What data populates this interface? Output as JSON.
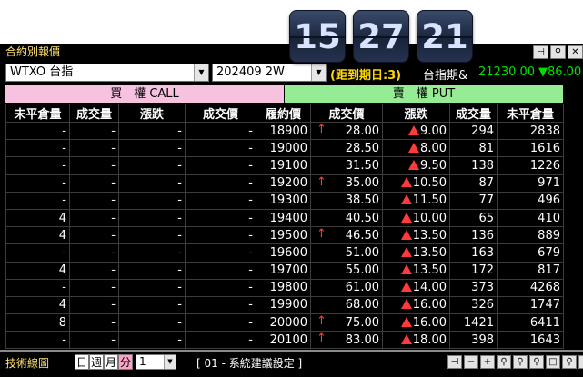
{
  "clock": {
    "hour": "15",
    "minute": "27",
    "second": "21"
  },
  "panel": {
    "title": "合約別報價",
    "title_buttons": [
      "⊣",
      "⚲",
      "✕"
    ]
  },
  "controls": {
    "product": "WTXO 台指",
    "month": "202409 2W",
    "expire_text": "(距到期日:3)",
    "index_name": "台指期&",
    "index_value": "21230.00",
    "index_change": "▼86.00"
  },
  "headers": {
    "call": "買　權 CALL",
    "put": "賣　權 PUT",
    "columns": [
      "未平倉量",
      "成交量",
      "漲跌",
      "成交價",
      "履約價",
      "成交價",
      "漲跌",
      "成交量",
      "未平倉量"
    ]
  },
  "rows": [
    {
      "c_oi": "-",
      "c_vol": "-",
      "c_chg": "-",
      "c_price": "-",
      "strike": "18900",
      "p_up": true,
      "p_price": "28.00",
      "p_chg": "9.00",
      "p_vol": "294",
      "p_oi": "2838"
    },
    {
      "c_oi": "-",
      "c_vol": "-",
      "c_chg": "-",
      "c_price": "-",
      "strike": "19000",
      "p_up": false,
      "p_price": "28.50",
      "p_chg": "8.00",
      "p_vol": "81",
      "p_oi": "1616"
    },
    {
      "c_oi": "-",
      "c_vol": "-",
      "c_chg": "-",
      "c_price": "-",
      "strike": "19100",
      "p_up": false,
      "p_price": "31.50",
      "p_chg": "9.50",
      "p_vol": "138",
      "p_oi": "1226"
    },
    {
      "c_oi": "-",
      "c_vol": "-",
      "c_chg": "-",
      "c_price": "-",
      "strike": "19200",
      "p_up": true,
      "p_price": "35.00",
      "p_chg": "10.50",
      "p_vol": "87",
      "p_oi": "971"
    },
    {
      "c_oi": "-",
      "c_vol": "-",
      "c_chg": "-",
      "c_price": "-",
      "strike": "19300",
      "p_up": false,
      "p_price": "38.50",
      "p_chg": "11.50",
      "p_vol": "77",
      "p_oi": "496"
    },
    {
      "c_oi": "4",
      "c_vol": "-",
      "c_chg": "-",
      "c_price": "-",
      "strike": "19400",
      "p_up": false,
      "p_price": "40.50",
      "p_chg": "10.00",
      "p_vol": "65",
      "p_oi": "410"
    },
    {
      "c_oi": "4",
      "c_vol": "-",
      "c_chg": "-",
      "c_price": "-",
      "strike": "19500",
      "p_up": true,
      "p_price": "46.50",
      "p_chg": "13.50",
      "p_vol": "136",
      "p_oi": "889"
    },
    {
      "c_oi": "-",
      "c_vol": "-",
      "c_chg": "-",
      "c_price": "-",
      "strike": "19600",
      "p_up": false,
      "p_price": "51.00",
      "p_chg": "13.50",
      "p_vol": "163",
      "p_oi": "679"
    },
    {
      "c_oi": "4",
      "c_vol": "-",
      "c_chg": "-",
      "c_price": "-",
      "strike": "19700",
      "p_up": false,
      "p_price": "55.00",
      "p_chg": "13.50",
      "p_vol": "172",
      "p_oi": "817"
    },
    {
      "c_oi": "-",
      "c_vol": "-",
      "c_chg": "-",
      "c_price": "-",
      "strike": "19800",
      "p_up": false,
      "p_price": "61.00",
      "p_chg": "14.00",
      "p_vol": "373",
      "p_oi": "4268"
    },
    {
      "c_oi": "4",
      "c_vol": "-",
      "c_chg": "-",
      "c_price": "-",
      "strike": "19900",
      "p_up": false,
      "p_price": "68.00",
      "p_chg": "16.00",
      "p_vol": "326",
      "p_oi": "1747"
    },
    {
      "c_oi": "8",
      "c_vol": "-",
      "c_chg": "-",
      "c_price": "-",
      "strike": "20000",
      "p_up": true,
      "p_price": "75.00",
      "p_chg": "16.00",
      "p_vol": "1421",
      "p_oi": "6411"
    },
    {
      "c_oi": "-",
      "c_vol": "-",
      "c_chg": "-",
      "c_price": "-",
      "strike": "20100",
      "p_up": true,
      "p_price": "83.00",
      "p_chg": "18.00",
      "p_vol": "398",
      "p_oi": "1643"
    }
  ],
  "bottom": {
    "title": "技術線圖",
    "periods": [
      "日",
      "週",
      "月",
      "分"
    ],
    "count": "1",
    "system": "[ 01 - 系統建議設定 ]",
    "buttons": [
      "⊣",
      "−",
      "+",
      "⚲",
      "⚲",
      "⚲",
      "□",
      "⚲",
      "⚲"
    ]
  },
  "colors": {
    "call_header": "#f7c2e0",
    "put_header": "#95ec95",
    "strike": "#ffd800",
    "up_red": "#ff3a3a",
    "down_green": "#00e000",
    "qty_blue": "#5db7ff"
  }
}
